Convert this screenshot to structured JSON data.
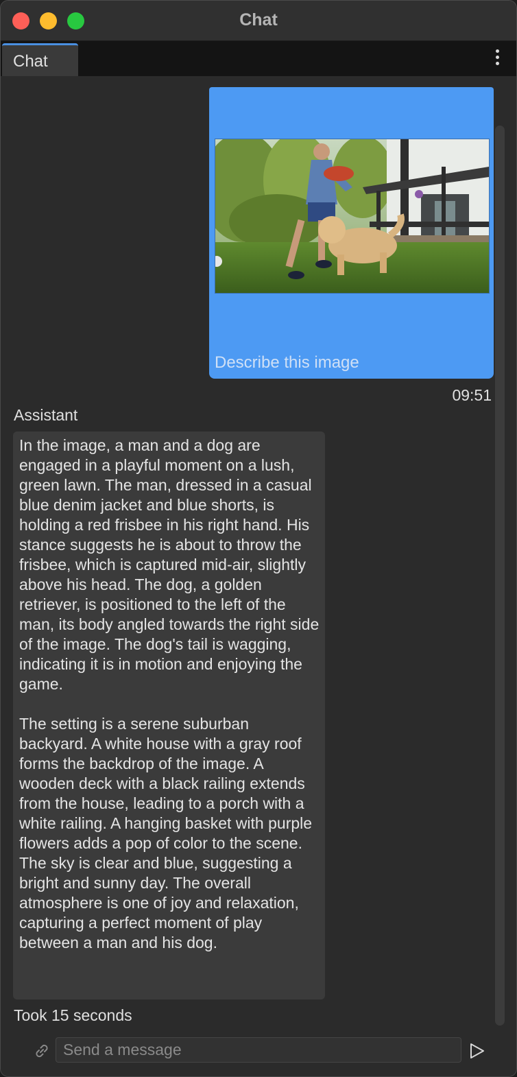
{
  "window": {
    "title": "Chat"
  },
  "tabs": [
    {
      "label": "Chat",
      "active": true
    }
  ],
  "messages": {
    "user": {
      "text": "Describe this image",
      "time": "09:51",
      "attachment_icon": "photo-attachment"
    },
    "assistant": {
      "label": "Assistant",
      "text": "In the image, a man and a dog are engaged in a playful moment on a lush, green lawn. The man, dressed in a casual blue denim jacket and blue shorts, is holding a red frisbee in his right hand. His stance suggests he is about to throw the frisbee, which is captured mid-air, slightly above his head. The dog, a golden retriever, is positioned to the left of the man, its body angled towards the right side of the image. The dog's tail is wagging, indicating it is in motion and enjoying the game.\n\nThe setting is a serene suburban backyard. A white house with a gray roof forms the backdrop of the image. A wooden deck with a black railing extends from the house, leading to a porch with a white railing. A hanging basket with purple flowers adds a pop of color to the scene. The sky is clear and blue, suggesting a bright and sunny day. The overall atmosphere is one of joy and relaxation, capturing a perfect moment of play between a man and his dog.",
      "took": "Took 15 seconds"
    }
  },
  "composer": {
    "placeholder": "Send a message",
    "value": ""
  },
  "icons": {
    "attach": "link-icon",
    "send": "send-icon",
    "menu": "more-vertical-icon"
  },
  "colors": {
    "user_bubble": "#4d9af3",
    "assistant_bubble": "#3b3b3b",
    "background": "#2b2b2b",
    "tab_accent": "#4a90e2"
  }
}
